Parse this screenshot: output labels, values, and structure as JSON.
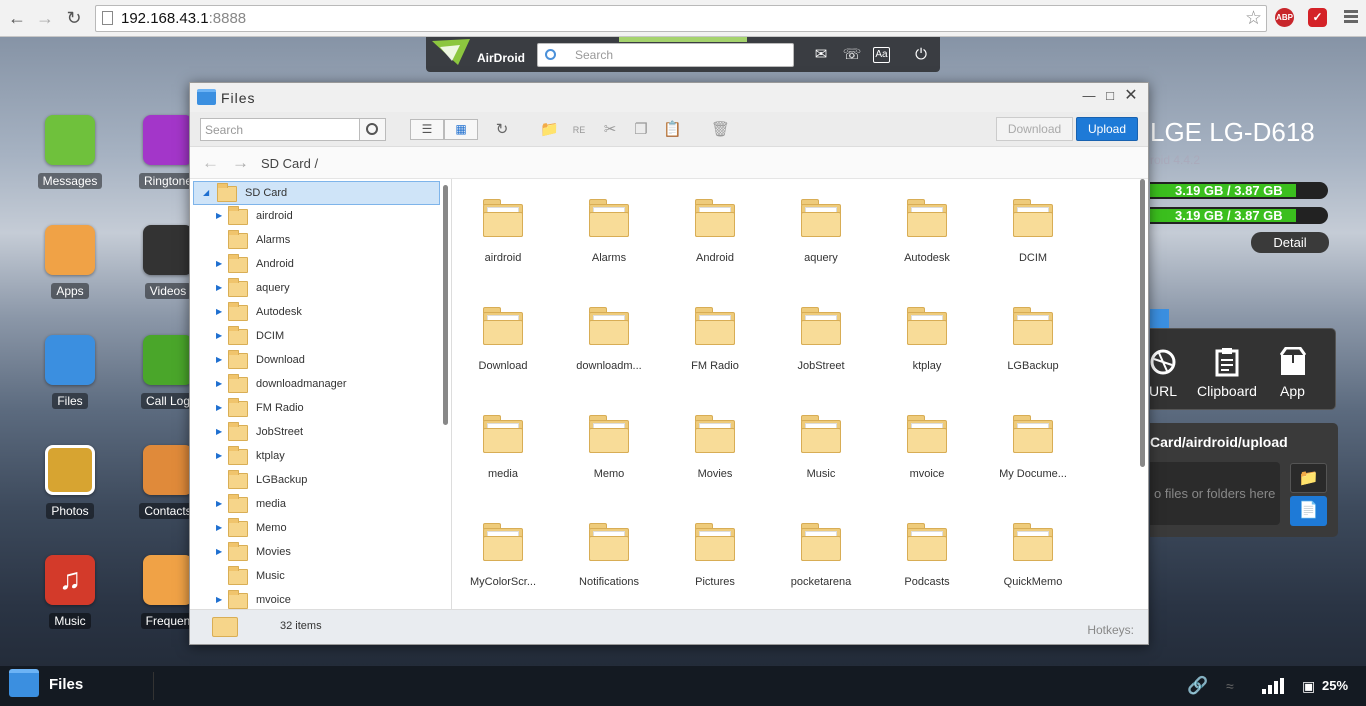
{
  "browser": {
    "url_host": "192.168.43.1",
    "url_port": ":8888",
    "ext_adblock": "ABP",
    "ext_red": "✓"
  },
  "airdroid": {
    "brand": "AirDroid",
    "search_placeholder": "Search",
    "icons": [
      "mail-icon",
      "phone-icon",
      "font-size-icon",
      "power-icon"
    ]
  },
  "desktop": [
    {
      "name": "Messages",
      "color": "#6fc13c"
    },
    {
      "name": "Ringtone",
      "color": "#a336c9"
    },
    {
      "name": "Apps",
      "color": "#f0a246"
    },
    {
      "name": "Videos",
      "color": "#333333"
    },
    {
      "name": "Files",
      "color": "#3b8fe0"
    },
    {
      "name": "Call Log",
      "color": "#4aa62a"
    },
    {
      "name": "Photos",
      "color": "#d7a431"
    },
    {
      "name": "Contacts",
      "color": "#e08a3a"
    },
    {
      "name": "Music",
      "color": "#d33a2a"
    },
    {
      "name": "Frequen",
      "color": "#f0a246"
    }
  ],
  "device": {
    "name": "LGE LG-D618",
    "version": "roid 4.4.2",
    "storage1": "3.19 GB / 3.87 GB",
    "storage2": "3.19 GB / 3.87 GB",
    "storage_fraction": 0.82,
    "detail": "Detail"
  },
  "toolbox": {
    "url": "URL",
    "clipboard": "Clipboard",
    "app": "App"
  },
  "upload_panel": {
    "path": "Card/airdroid/upload",
    "drop_text": "o files or folders here"
  },
  "files_window": {
    "title": "Files",
    "search_placeholder": "Search",
    "download": "Download",
    "upload": "Upload",
    "breadcrumb": "SD Card /",
    "tree_root": "SD Card",
    "tree": [
      {
        "name": "airdroid",
        "expand": true
      },
      {
        "name": "Alarms",
        "expand": false
      },
      {
        "name": "Android",
        "expand": true
      },
      {
        "name": "aquery",
        "expand": true
      },
      {
        "name": "Autodesk",
        "expand": true
      },
      {
        "name": "DCIM",
        "expand": true
      },
      {
        "name": "Download",
        "expand": true
      },
      {
        "name": "downloadmanager",
        "expand": true
      },
      {
        "name": "FM Radio",
        "expand": true
      },
      {
        "name": "JobStreet",
        "expand": true
      },
      {
        "name": "ktplay",
        "expand": true
      },
      {
        "name": "LGBackup",
        "expand": false
      },
      {
        "name": "media",
        "expand": true
      },
      {
        "name": "Memo",
        "expand": true
      },
      {
        "name": "Movies",
        "expand": true
      },
      {
        "name": "Music",
        "expand": false
      },
      {
        "name": "mvoice",
        "expand": true
      }
    ],
    "grid": [
      "airdroid",
      "Alarms",
      "Android",
      "aquery",
      "Autodesk",
      "DCIM",
      "Download",
      "downloadm...",
      "FM Radio",
      "JobStreet",
      "ktplay",
      "LGBackup",
      "media",
      "Memo",
      "Movies",
      "Music",
      "mvoice",
      "My Docume...",
      "MyColorScr...",
      "Notifications",
      "Pictures",
      "pocketarena",
      "Podcasts",
      "QuickMemo"
    ],
    "count": "32 items",
    "hotkeys": "Hotkeys:"
  },
  "taskbar": {
    "files": "Files",
    "battery": "25%"
  }
}
